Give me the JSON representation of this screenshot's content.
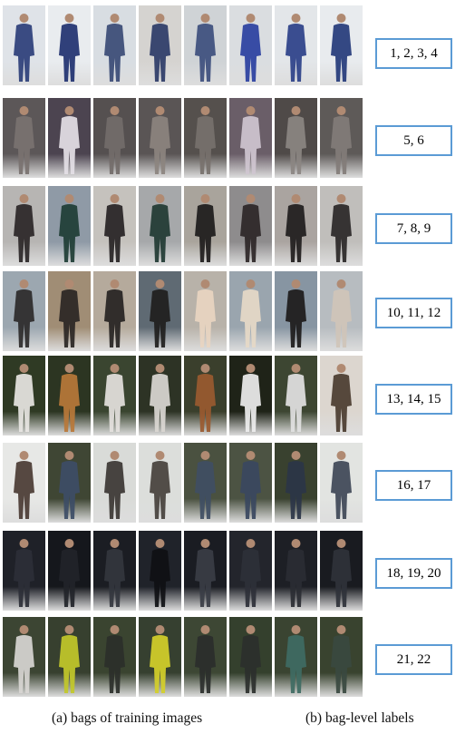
{
  "labels": [
    "1, 2, 3, 4",
    "5, 6",
    "7, 8, 9",
    "10, 11, 12",
    "13, 14, 15",
    "16, 17",
    "18, 19, 20",
    "21, 22"
  ],
  "captions": {
    "left": "(a) bags of  training images",
    "right": "(b) bag-level labels"
  },
  "rows": [
    {
      "bg": [
        "#dfe3e8",
        "#e9ecef",
        "#d8dde2",
        "#d5d3d0",
        "#cfd3d6",
        "#dadde0",
        "#e3e6e9",
        "#e8ebee"
      ],
      "fig": [
        "#2b3e78",
        "#1f3170",
        "#3a4a75",
        "#2d3b67",
        "#3d4e7d",
        "#2a3fa0",
        "#2b4088",
        "#243a7a"
      ]
    },
    {
      "bg": [
        "#5c5758",
        "#4c4450",
        "#555050",
        "#5a5555",
        "#55504d",
        "#6a5e68",
        "#4f4a48",
        "#5e5a58"
      ],
      "fig": [
        "#7a7270",
        "#e4dfe6",
        "#736c6a",
        "#8c847f",
        "#77716c",
        "#cfc6d0",
        "#8b8582",
        "#827c78"
      ]
    },
    {
      "bg": [
        "#b7b5b3",
        "#8f9aa6",
        "#c5c2bd",
        "#a6a8aa",
        "#a9a49c",
        "#8e8c8d",
        "#aaa4a0",
        "#c0bebb"
      ],
      "fig": [
        "#2a2627",
        "#1e3d35",
        "#262324",
        "#213a33",
        "#1d1b1b",
        "#2c2627",
        "#1f1c1c",
        "#2a2727"
      ]
    },
    {
      "bg": [
        "#9ca7b0",
        "#a08d75",
        "#b5aa9c",
        "#5f6a73",
        "#b8b2a9",
        "#9aa5ae",
        "#8795a2",
        "#b7bcc0"
      ],
      "fig": [
        "#2d2a2a",
        "#2a2624",
        "#262322",
        "#1f1e1d",
        "#e8d5c1",
        "#e6d9c7",
        "#1c1a1a",
        "#cfc4b8"
      ]
    },
    {
      "bg": [
        "#2f3a24",
        "#2c3522",
        "#3a4530",
        "#2d3325",
        "#3a3f2c",
        "#1f2318",
        "#3d4632",
        "#dcd6cf"
      ],
      "fig": [
        "#e8e6e3",
        "#b8783a",
        "#e5e2de",
        "#dad7d3",
        "#9a5a30",
        "#eeeeee",
        "#e2e2e2",
        "#4a3c30"
      ]
    },
    {
      "bg": [
        "#e7e8e6",
        "#3f4634",
        "#d9dbd8",
        "#dcdedb",
        "#4a5140",
        "#4c5343",
        "#39412f",
        "#e2e4e1"
      ],
      "fig": [
        "#4a3a33",
        "#3d4d66",
        "#3b3633",
        "#45403c",
        "#3f4e63",
        "#3a4860",
        "#2b3548",
        "#3e4656"
      ]
    },
    {
      "bg": [
        "#1f2128",
        "#15171c",
        "#1b1d23",
        "#20232a",
        "#1a1c22",
        "#23252c",
        "#1d1f25",
        "#191b20"
      ],
      "fig": [
        "#2c2f37",
        "#222429",
        "#33363e",
        "#0f1013",
        "#3a3d45",
        "#2e3038",
        "#2a2c33",
        "#2f3239"
      ]
    },
    {
      "bg": [
        "#3c4533",
        "#37402f",
        "#3a4430",
        "#364030",
        "#3d4734",
        "#34402d",
        "#3a4431",
        "#39432f"
      ],
      "fig": [
        "#d8d6d2",
        "#c2c82a",
        "#2b2f2a",
        "#d4cf2a",
        "#2a2e2b",
        "#2b2f2c",
        "#3f6b63",
        "#3a4940"
      ]
    }
  ]
}
